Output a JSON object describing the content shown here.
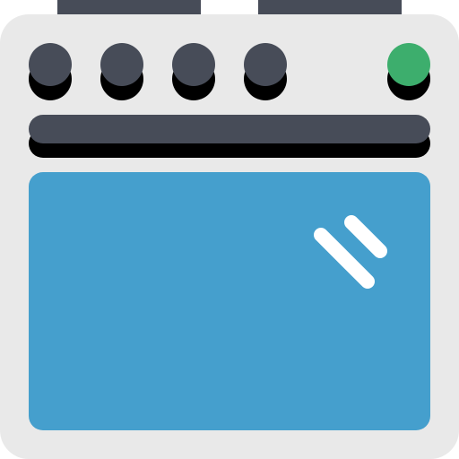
{
  "icon": {
    "name": "oven-icon",
    "colors": {
      "body": "#E9E9E9",
      "top_handles": "#474C58",
      "knob": "#474C58",
      "knob_shadow": "#000000",
      "indicator_light": "#3DAE6D",
      "door_handle": "#474C58",
      "door_handle_shadow": "#000000",
      "window": "#459FCD",
      "glare": "#FFFFFF"
    },
    "knobs": [
      {
        "name": "knob-1",
        "type": "dial"
      },
      {
        "name": "knob-2",
        "type": "dial"
      },
      {
        "name": "knob-3",
        "type": "dial"
      },
      {
        "name": "knob-4",
        "type": "dial"
      },
      {
        "name": "power-indicator-light",
        "type": "indicator"
      }
    ]
  }
}
